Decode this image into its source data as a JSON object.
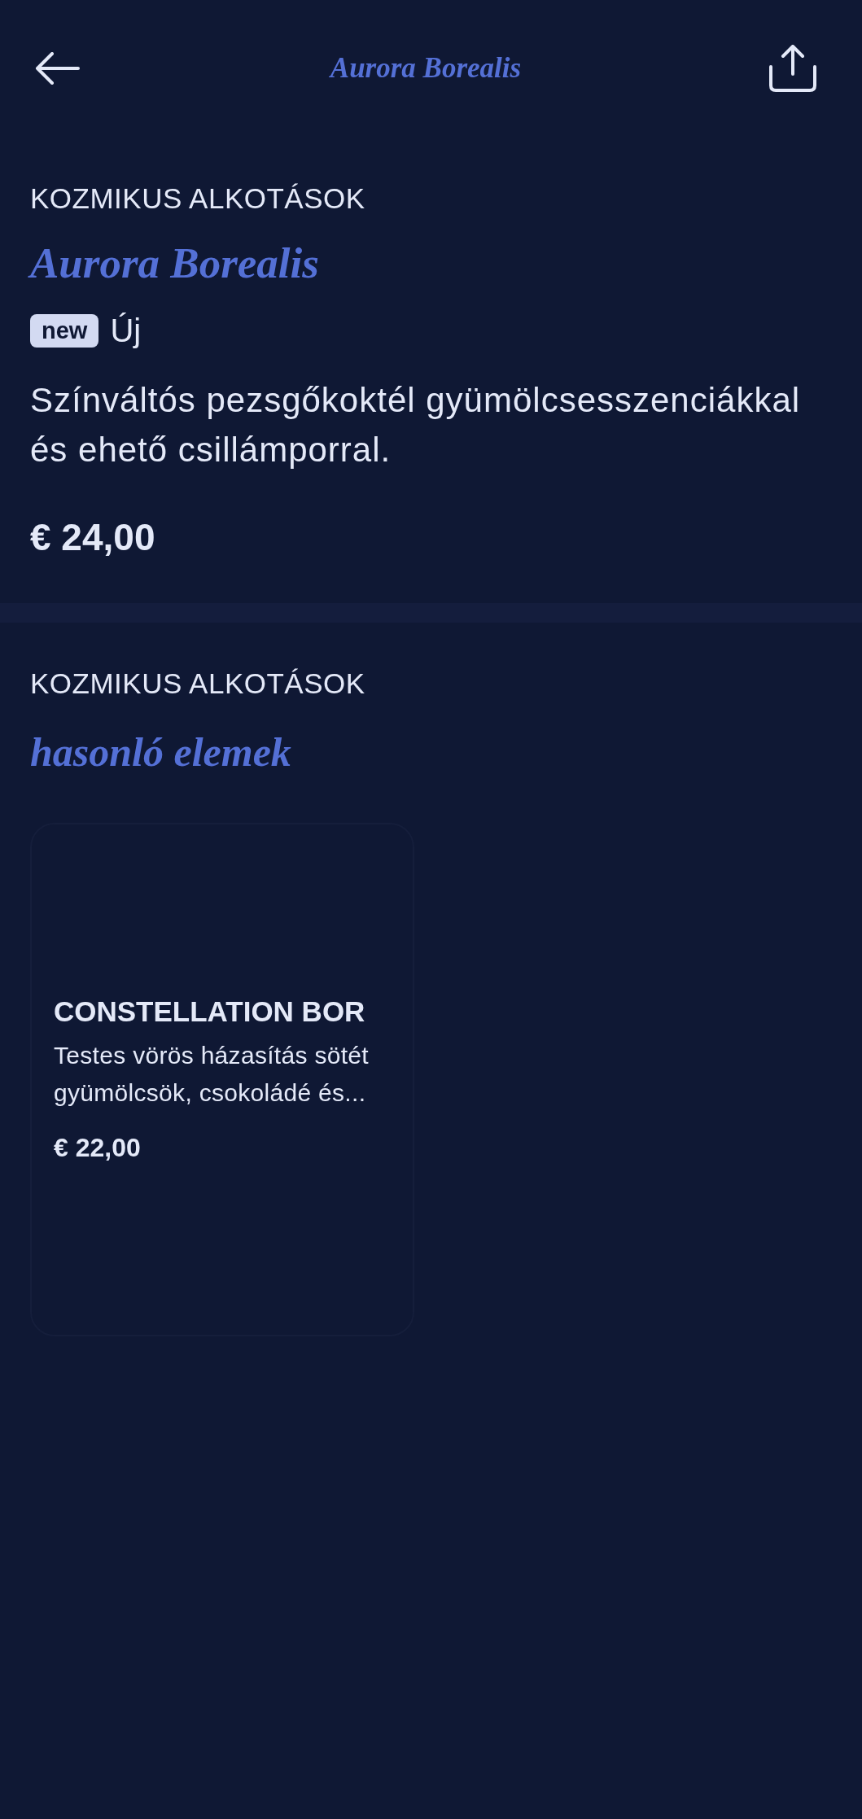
{
  "header": {
    "title": "Aurora Borealis"
  },
  "product": {
    "category": "KOZMIKUS ALKOTÁSOK",
    "name": "Aurora Borealis",
    "badge": "new",
    "badge_label": "Új",
    "description": "Színváltós pezsgőkoktél gyümölcsesszenciákkal és ehető csillámporral.",
    "price": "€ 24,00"
  },
  "similar": {
    "category": "KOZMIKUS ALKOTÁSOK",
    "heading": "hasonló elemek",
    "items": [
      {
        "name": "CONSTELLATION BOR",
        "description": "Testes vörös házasítás sötét gyümölcsök, csokoládé és...",
        "price": "€ 22,00"
      }
    ]
  }
}
